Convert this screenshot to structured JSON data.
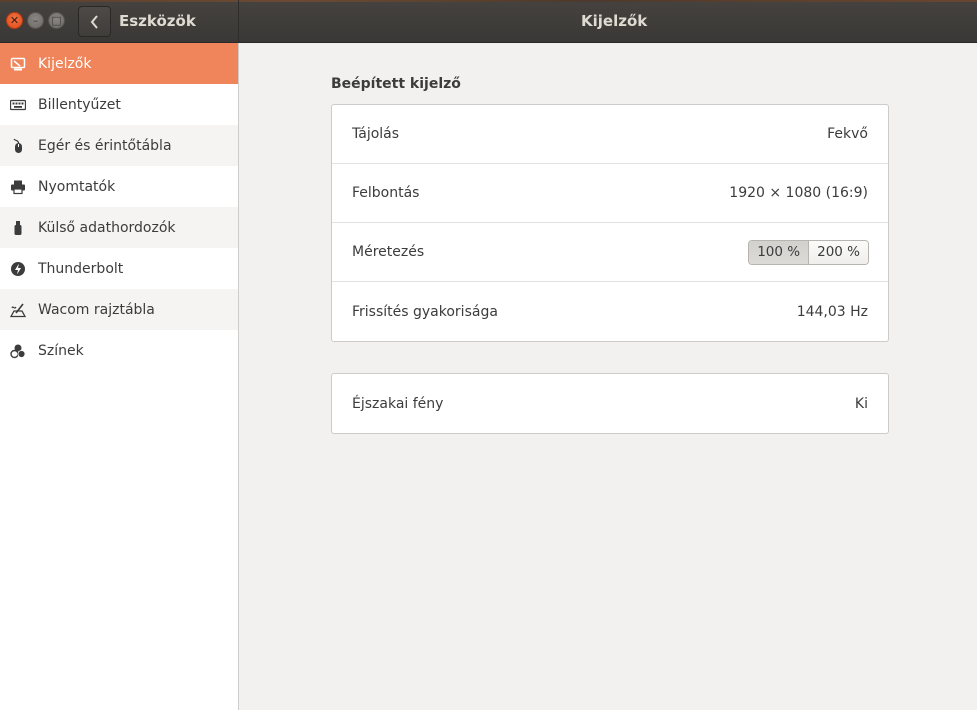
{
  "header": {
    "sidebar_title": "Eszközök",
    "main_title": "Kijelzők",
    "window_buttons": [
      "close-icon",
      "minimize-icon",
      "maximize-icon"
    ]
  },
  "sidebar": {
    "items": [
      {
        "label": "Kijelzők",
        "icon": "display-icon",
        "selected": true
      },
      {
        "label": "Billentyűzet",
        "icon": "keyboard-icon"
      },
      {
        "label": "Egér és érintőtábla",
        "icon": "mouse-icon"
      },
      {
        "label": "Nyomtatók",
        "icon": "printer-icon"
      },
      {
        "label": "Külső adathordozók",
        "icon": "usb-drive-icon"
      },
      {
        "label": "Thunderbolt",
        "icon": "thunderbolt-icon"
      },
      {
        "label": "Wacom rajztábla",
        "icon": "tablet-icon"
      },
      {
        "label": "Színek",
        "icon": "colors-icon"
      }
    ]
  },
  "main": {
    "section_title": "Beépített kijelző",
    "display_settings": [
      {
        "label": "Tájolás",
        "value": "Fekvő"
      },
      {
        "label": "Felbontás",
        "value": "1920 × 1080 (16:9)"
      },
      {
        "label": "Méretezés",
        "options": [
          "100 %",
          "200 %"
        ],
        "selected": "100 %"
      },
      {
        "label": "Frissítés gyakorisága",
        "value": "144,03 Hz"
      }
    ],
    "night_light": {
      "label": "Éjszakai fény",
      "value": "Ki"
    }
  },
  "colors": {
    "accent": "#f0845a",
    "headerbar": "#3d3a37",
    "close_button": "#e95420"
  }
}
